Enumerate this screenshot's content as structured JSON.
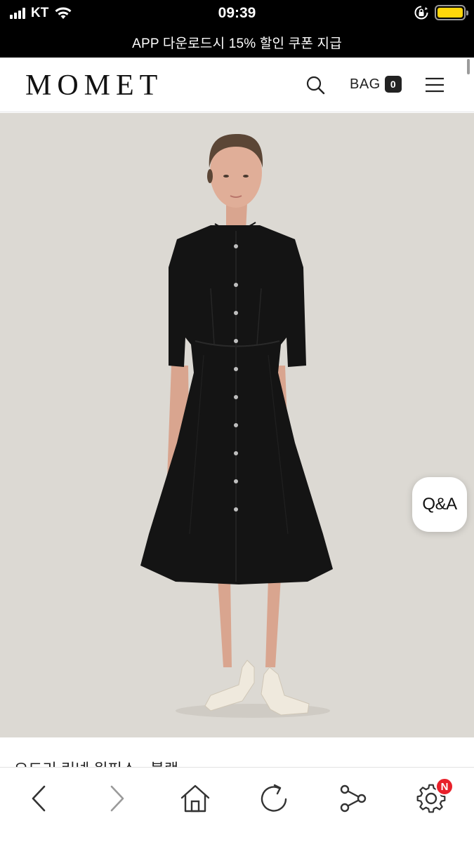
{
  "status_bar": {
    "carrier": "KT",
    "time": "09:39",
    "icons": [
      "signal-icon",
      "wifi-icon",
      "rotation-lock-icon",
      "battery-icon"
    ],
    "battery_color": "#ffd60a"
  },
  "promo_banner": {
    "text": "APP 다운로드시 15% 할인 쿠폰 지급"
  },
  "header": {
    "logo": "MOMET",
    "search_icon": "search-icon",
    "bag_label": "BAG",
    "bag_count": "0",
    "menu_icon": "hamburger-menu-icon"
  },
  "product": {
    "image_alt": "model wearing black shirt dress",
    "title": "오드리 린넨 원피스 - 블랙",
    "dress_color": "#141414",
    "background_color": "#dcd9d3"
  },
  "floating": {
    "qa_label": "Q&A"
  },
  "toolbar": {
    "items": [
      {
        "name": "back",
        "icon": "chevron-left-icon"
      },
      {
        "name": "forward",
        "icon": "chevron-right-icon"
      },
      {
        "name": "home",
        "icon": "home-icon"
      },
      {
        "name": "reload",
        "icon": "reload-icon"
      },
      {
        "name": "share",
        "icon": "share-icon"
      },
      {
        "name": "settings",
        "icon": "gear-icon"
      }
    ],
    "settings_badge": "N",
    "badge_color": "#e8202a"
  }
}
